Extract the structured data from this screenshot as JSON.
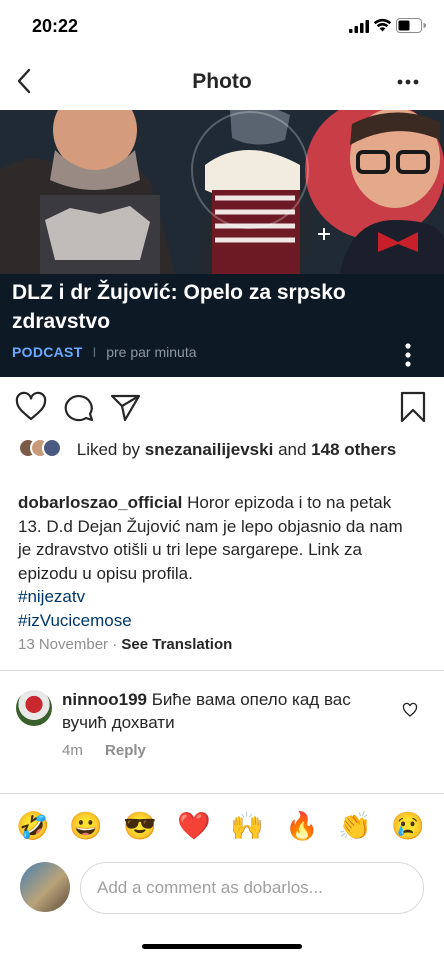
{
  "status_bar": {
    "time": "20:22"
  },
  "navbar": {
    "title": "Photo"
  },
  "post_image": {
    "headline": "DLZ i dr Žujović: Opelo za srpsko zdravstvo",
    "podcast_tag": "PODCAST",
    "separator": "I",
    "posted": "pre par minuta"
  },
  "likes": {
    "prefix": "Liked by",
    "user": "snezanailijevski",
    "connector": "and",
    "count_text": "148 others"
  },
  "caption": {
    "username": "dobarloszao_official",
    "text": "Horor epizoda i to na petak 13. D.d Dejan Žujović nam je lepo objasnio da nam je zdravstvo otišli u tri lepe sargarepe. Link za epizodu u opisu profila.",
    "hashtags": [
      "#nijezatv",
      "#izVucicemose"
    ]
  },
  "post_meta": {
    "date": "13 November",
    "dot": "·",
    "see_translation": "See Translation"
  },
  "comment": {
    "username": "ninnoo199",
    "text": "Биће вама опело кад вас вучић дохвати",
    "age": "4m",
    "reply": "Reply"
  },
  "emoji_bar": [
    "🤣",
    "😀",
    "😎",
    "❤️",
    "🙌",
    "🔥",
    "👏",
    "😢"
  ],
  "compose": {
    "placeholder": "Add a comment as dobarlos..."
  },
  "colors": {
    "link": "#00376b",
    "podcast_accent": "#6aa9ff",
    "image_bg": "#0d1a26",
    "heart_red": "#e0245e"
  }
}
